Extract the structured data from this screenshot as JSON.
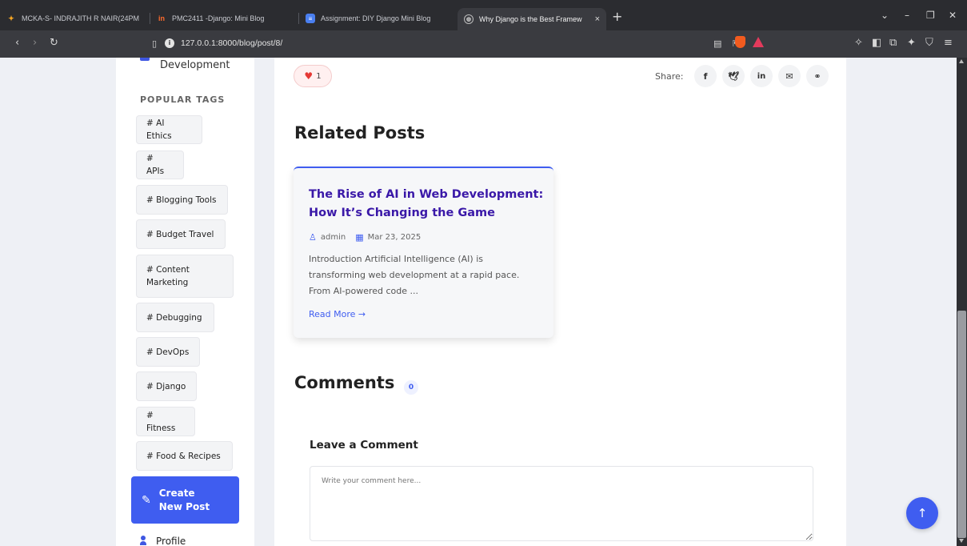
{
  "browser": {
    "tabs": [
      {
        "label": "MCKA-S- INDRAJITH R NAIR(24PM",
        "icon": "moodle-icon",
        "active": false
      },
      {
        "label": "PMC2411 -Django: Mini Blog",
        "icon": "linways-icon",
        "active": false
      },
      {
        "label": "Assignment: DIY Django Mini Blog",
        "icon": "docs-icon",
        "active": false
      },
      {
        "label": "Why Django is the Best Framew",
        "icon": "globe-icon",
        "active": true
      }
    ],
    "close_glyph": "×",
    "new_tab_glyph": "+",
    "url": "127.0.0.1:8000/blog/post/8/"
  },
  "sidebar": {
    "category_label": "Development",
    "tags_title": "POPULAR TAGS",
    "tags": [
      "# AI Ethics",
      "# APIs",
      "# Blogging Tools",
      "# Budget Travel",
      "# Content Marketing",
      "# Debugging",
      "# DevOps",
      "# Django",
      "# Fitness",
      "# Food & Recipes"
    ],
    "create_button": "Create New Post",
    "profile_label": "Profile"
  },
  "post": {
    "likes": "1",
    "share_label": "Share:",
    "share_icons": [
      "facebook-icon",
      "twitter-icon",
      "linkedin-icon",
      "email-icon",
      "link-icon"
    ]
  },
  "related": {
    "title": "Related Posts",
    "card": {
      "title": "The Rise of AI in Web Development: How It’s Changing the Game",
      "author": "admin",
      "date": "Mar 23, 2025",
      "excerpt": "Introduction Artificial Intelligence (AI) is transforming web development at a rapid pace. From AI-powered code ...",
      "read_more": "Read More →"
    }
  },
  "comments": {
    "title": "Comments",
    "count": "0",
    "form_title": "Leave a Comment",
    "placeholder": "Write your comment here..."
  },
  "colors": {
    "accent": "#3f5df0",
    "card_title": "#3a18a8",
    "like": "#e53935"
  }
}
